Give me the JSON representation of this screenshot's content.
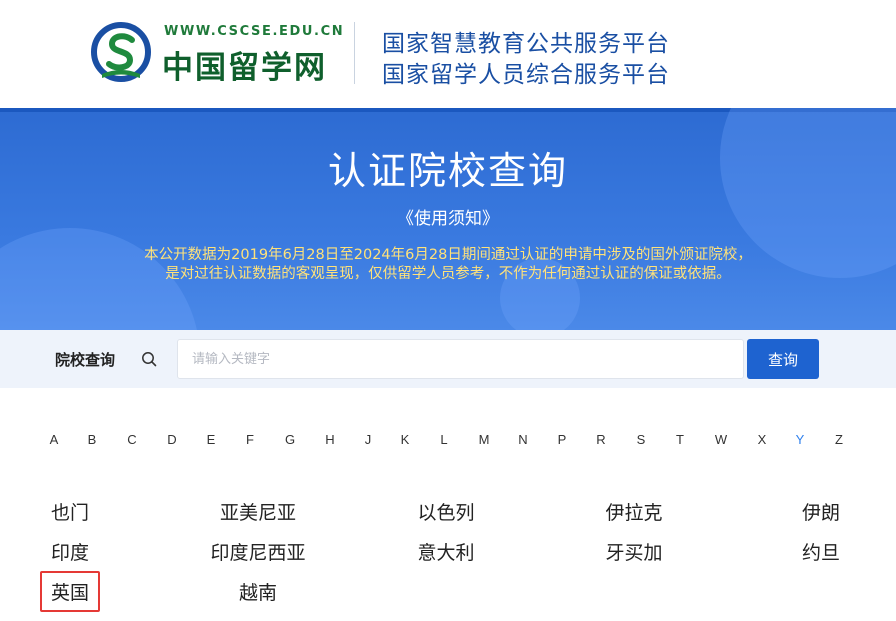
{
  "header": {
    "logo_url_text": "WWW.CSCSE.EDU.CN",
    "logo_name": "中国留学网",
    "platform_line_1": "国家智慧教育公共服务平台",
    "platform_line_2": "国家留学人员综合服务平台"
  },
  "banner": {
    "title": "认证院校查询",
    "notice_link": "《使用须知》",
    "description_line_1": "本公开数据为2019年6月28日至2024年6月28日期间通过认证的申请中涉及的国外颁证院校，",
    "description_line_2": "是对过往认证数据的客观呈现，仅供留学人员参考，不作为任何通过认证的保证或依据。"
  },
  "search": {
    "label": "院校查询",
    "placeholder": "请输入关键字",
    "value": "",
    "button_label": "查询",
    "icon": "search-icon"
  },
  "alphabet": {
    "letters": [
      "A",
      "B",
      "C",
      "D",
      "E",
      "F",
      "G",
      "H",
      "J",
      "K",
      "L",
      "M",
      "N",
      "P",
      "R",
      "S",
      "T",
      "W",
      "X",
      "Y",
      "Z"
    ],
    "active": "Y"
  },
  "countries": [
    "也门",
    "亚美尼亚",
    "以色列",
    "伊拉克",
    "伊朗",
    "印度",
    "印度尼西亚",
    "意大利",
    "牙买加",
    "约旦",
    "英国",
    "越南"
  ],
  "highlighted_country": "英国",
  "colors": {
    "banner_blue": "#3a7ae0",
    "button_blue": "#1e63d0",
    "notice_yellow": "#ffe27a",
    "active_letter": "#2f80ed",
    "highlight_red": "#e53935",
    "logo_green": "#0f5f2c"
  }
}
